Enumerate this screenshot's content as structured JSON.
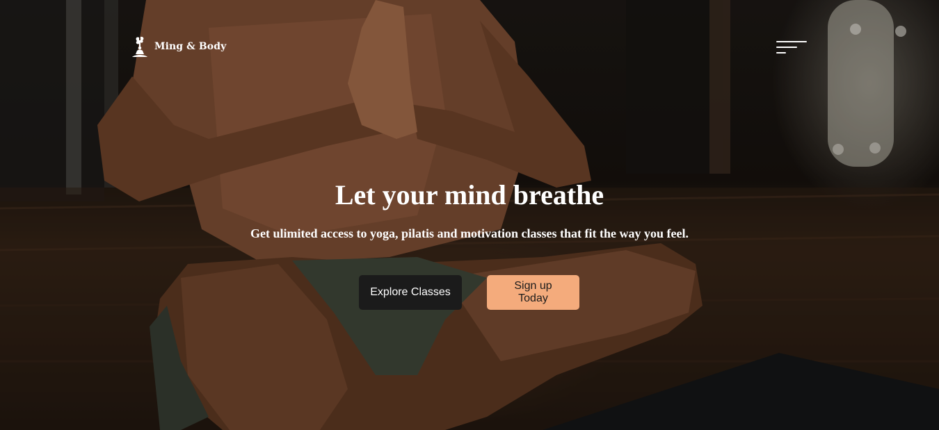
{
  "brand": {
    "name": "Ming & Body",
    "logo_icon": "meditation-tree-icon"
  },
  "nav": {
    "menu_icon": "hamburger-menu-icon"
  },
  "hero": {
    "title": "Let your mind breathe",
    "subtitle": "Get ulimited access to yoga, pilatis and motivation classes that fit the way you feel.",
    "primary_button": "Explore Classes",
    "secondary_button": "Sign up Today"
  },
  "colors": {
    "primary_button_bg": "#1b1b1b",
    "secondary_button_bg": "#f4ab7c",
    "text": "#ffffff"
  }
}
